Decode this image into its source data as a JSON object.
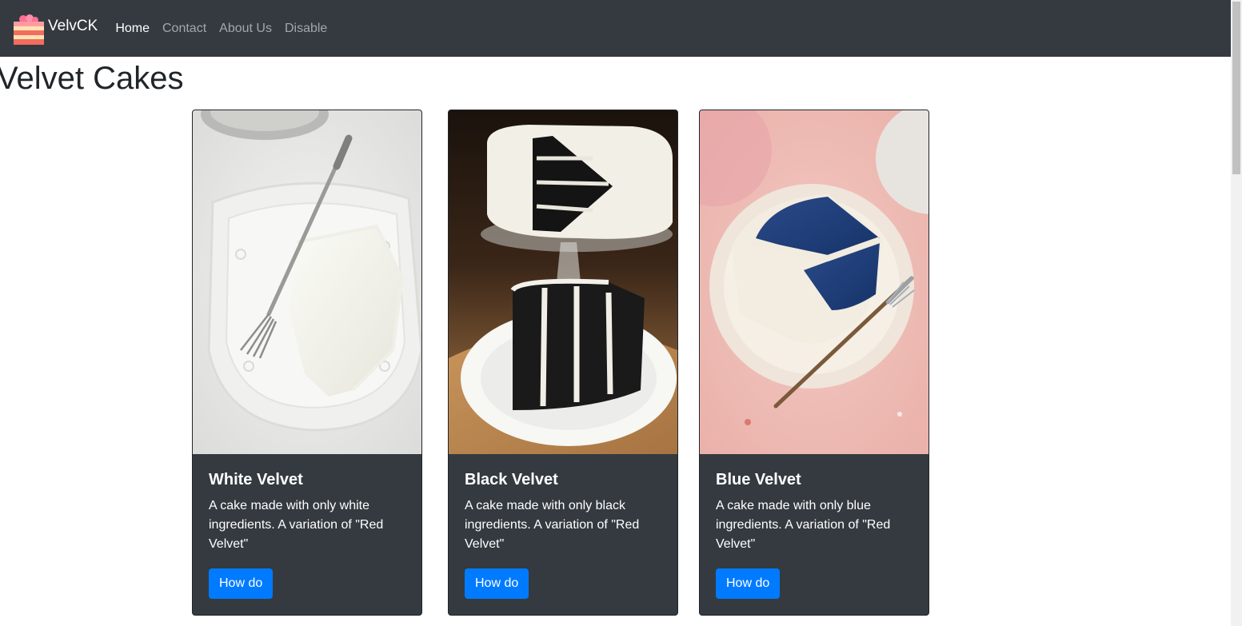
{
  "navbar": {
    "brand": "VelvCK",
    "links": [
      {
        "label": "Home",
        "active": true
      },
      {
        "label": "Contact",
        "active": false
      },
      {
        "label": "About Us",
        "active": false
      },
      {
        "label": "Disable",
        "active": false
      }
    ]
  },
  "page": {
    "title": "Velvet Cakes"
  },
  "cards": [
    {
      "title": "White Velvet",
      "text": "A cake made with only white ingredients. A variation of \"Red Velvet\"",
      "button": "How do"
    },
    {
      "title": "Black Velvet",
      "text": "A cake made with only black ingredients. A variation of \"Red Velvet\"",
      "button": "How do"
    },
    {
      "title": "Blue Velvet",
      "text": "A cake made with only blue ingredients. A variation of \"Red Velvet\"",
      "button": "How do"
    }
  ],
  "colors": {
    "navbar_bg": "#343a40",
    "card_bg": "#343a40",
    "button_bg": "#007bff"
  }
}
